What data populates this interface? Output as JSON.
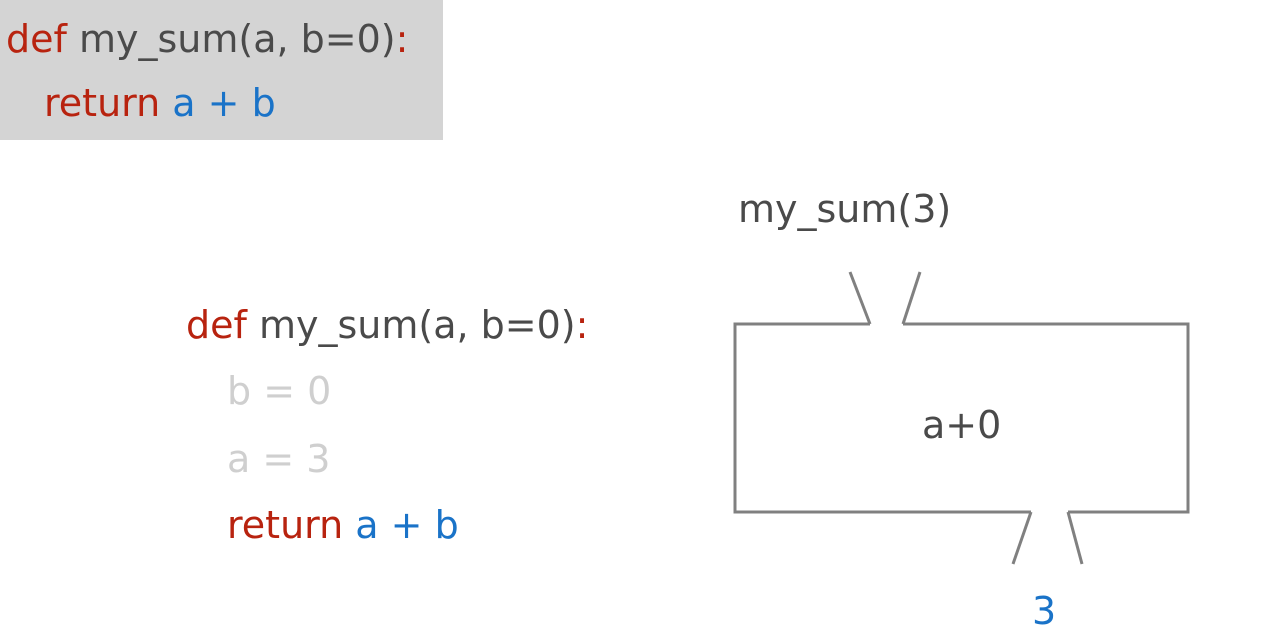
{
  "top_code": {
    "def_kw": "def",
    "signature": " my_sum(a, b=0)",
    "colon": ":",
    "return_kw": "return",
    "return_expr": " a + b"
  },
  "middle_code": {
    "def_kw": "def",
    "signature": " my_sum(a, b=0)",
    "colon": ":",
    "line_b": "b = 0",
    "line_a": "a = 3",
    "return_kw": "return",
    "return_expr": " a + b"
  },
  "machine": {
    "call_label": "my_sum(3)",
    "body_label": "a+0",
    "output_label": "3"
  },
  "colors": {
    "keyword": "#b8230f",
    "text": "#4a4a4a",
    "variable": "#1a73c8",
    "faded": "#cfcfcf",
    "box_fill": "#d4d4d4",
    "outline": "#808080"
  }
}
